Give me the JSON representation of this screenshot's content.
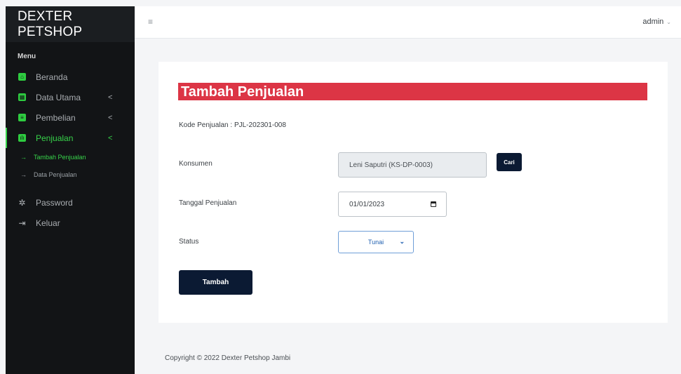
{
  "brand": "DEXTER PETSHOP",
  "sidebar": {
    "heading": "Menu",
    "items": [
      {
        "label": "Beranda",
        "icon": "home-icon"
      },
      {
        "label": "Data Utama",
        "icon": "table-icon",
        "caret": "<"
      },
      {
        "label": "Pembelian",
        "icon": "list-icon",
        "caret": "<"
      },
      {
        "label": "Penjualan",
        "icon": "chart-icon",
        "caret": "<"
      }
    ],
    "subitems": [
      {
        "label": "Tambah Penjualan",
        "arrow": "→"
      },
      {
        "label": "Data Penjualan",
        "arrow": "→"
      }
    ],
    "extra": [
      {
        "label": "Password",
        "icon": "gear-icon"
      },
      {
        "label": "Keluar",
        "icon": "logout-icon"
      }
    ]
  },
  "topbar": {
    "menu_icon": "≡",
    "user": "admin",
    "user_caret": "⌄"
  },
  "form": {
    "title": "Tambah Penjualan",
    "kode": "Kode Penjualan : PJL-202301-008",
    "konsumen_label": "Konsumen",
    "konsumen_value": "Leni Saputri (KS-DP-0003)",
    "cari_label": "Cari",
    "tanggal_label": "Tanggal Penjualan",
    "tanggal_value": "01/01/2023",
    "status_label": "Status",
    "status_value": "Tunai",
    "submit_label": "Tambah"
  },
  "footer": "Copyright © 2022 Dexter Petshop Jambi",
  "colors": {
    "sidebar_bg": "#121416",
    "accent_green": "#37d34a",
    "title_red": "#dc3545",
    "button_navy": "#0b1a33"
  }
}
